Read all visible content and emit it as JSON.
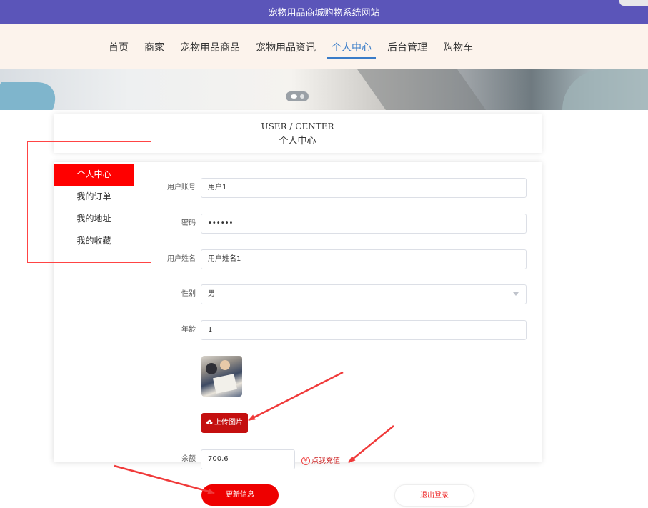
{
  "site": {
    "title": "宠物用品商城购物系统网站"
  },
  "nav": {
    "items": [
      {
        "label": "首页"
      },
      {
        "label": "商家"
      },
      {
        "label": "宠物用品商品"
      },
      {
        "label": "宠物用品资讯"
      },
      {
        "label": "个人中心",
        "active": true
      },
      {
        "label": "后台管理"
      },
      {
        "label": "购物车"
      }
    ]
  },
  "section": {
    "title_en": "USER / CENTER",
    "title_cn": "个人中心"
  },
  "sidebar": {
    "items": [
      {
        "label": "个人中心",
        "active": true
      },
      {
        "label": "我的订单"
      },
      {
        "label": "我的地址"
      },
      {
        "label": "我的收藏"
      }
    ]
  },
  "form": {
    "account": {
      "label": "用户账号",
      "value": "用户1"
    },
    "password": {
      "label": "密码",
      "value": "••••••"
    },
    "name": {
      "label": "用户姓名",
      "value": "用户姓名1"
    },
    "gender": {
      "label": "性别",
      "value": "男"
    },
    "age": {
      "label": "年龄",
      "value": "1"
    },
    "upload_label": "上传图片",
    "balance": {
      "label": "余额",
      "value": "700.6"
    },
    "recharge_label": "点我充值",
    "yen_symbol": "¥"
  },
  "actions": {
    "update_label": "更新信息",
    "logout_label": "退出登录"
  },
  "colors": {
    "topbar": "#5b55b9",
    "navbar_bg": "#fcf3ec",
    "accent_red": "#ee0000",
    "nav_active": "#3a7cc8"
  },
  "icons": {
    "upload": "cloud-upload-icon",
    "recharge": "yen-circle-icon",
    "select": "chevron-down-icon"
  }
}
